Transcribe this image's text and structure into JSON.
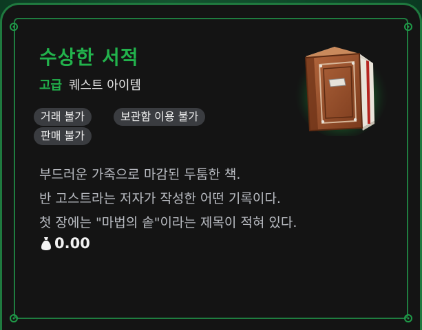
{
  "item": {
    "name": "수상한 서적",
    "grade": "고급",
    "type": "퀘스트 아이템",
    "icon": "leather-book-icon"
  },
  "tags": [
    "거래 불가",
    "보관함 이용 불가",
    "판매 불가"
  ],
  "description": [
    "부드러운 가죽으로 마감된 두툼한 책.",
    "반 고스트라는 저자가 작성한 어떤 기록이다.",
    "첫 장에는 \"마법의 솥\"이라는 제목이 적혀 있다."
  ],
  "price": {
    "icon": "money-bag-icon",
    "value": "0.00"
  },
  "colors": {
    "title": "#22b24c",
    "frame": "#1f7d40",
    "background": "#141414",
    "tag_bg": "#3a3c40",
    "description": "#b9bcc2"
  }
}
